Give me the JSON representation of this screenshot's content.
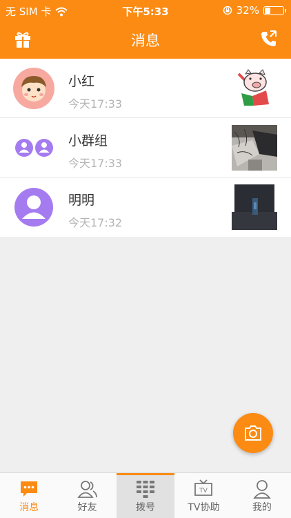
{
  "status_bar": {
    "carrier": "无 SIM 卡",
    "time": "下午5:33",
    "battery_text": "32%",
    "battery_level": 0.32
  },
  "nav": {
    "title": "消息",
    "left_icon": "gift-icon",
    "right_icon": "phone-icon"
  },
  "conversations": [
    {
      "name": "小红",
      "time": "今天17:33",
      "avatar": "cartoon-boy-avatar",
      "thumb": "cartoon-pig-sticker"
    },
    {
      "name": "小群组",
      "time": "今天17:33",
      "avatar": "group-avatar",
      "thumb": "desk-photo"
    },
    {
      "name": "明明",
      "time": "今天17:32",
      "avatar": "person-avatar",
      "thumb": "dark-photo"
    }
  ],
  "tabs": [
    {
      "label": "消息",
      "icon": "message-icon",
      "active": true
    },
    {
      "label": "好友",
      "icon": "friends-icon"
    },
    {
      "label": "拨号",
      "icon": "dialpad-icon"
    },
    {
      "label": "TV协助",
      "icon": "tv-icon"
    },
    {
      "label": "我的",
      "icon": "user-icon"
    }
  ],
  "colors": {
    "accent": "#fb8b13",
    "avatar_purple": "#a57cf0",
    "avatar_pink": "#f7a9a0"
  }
}
